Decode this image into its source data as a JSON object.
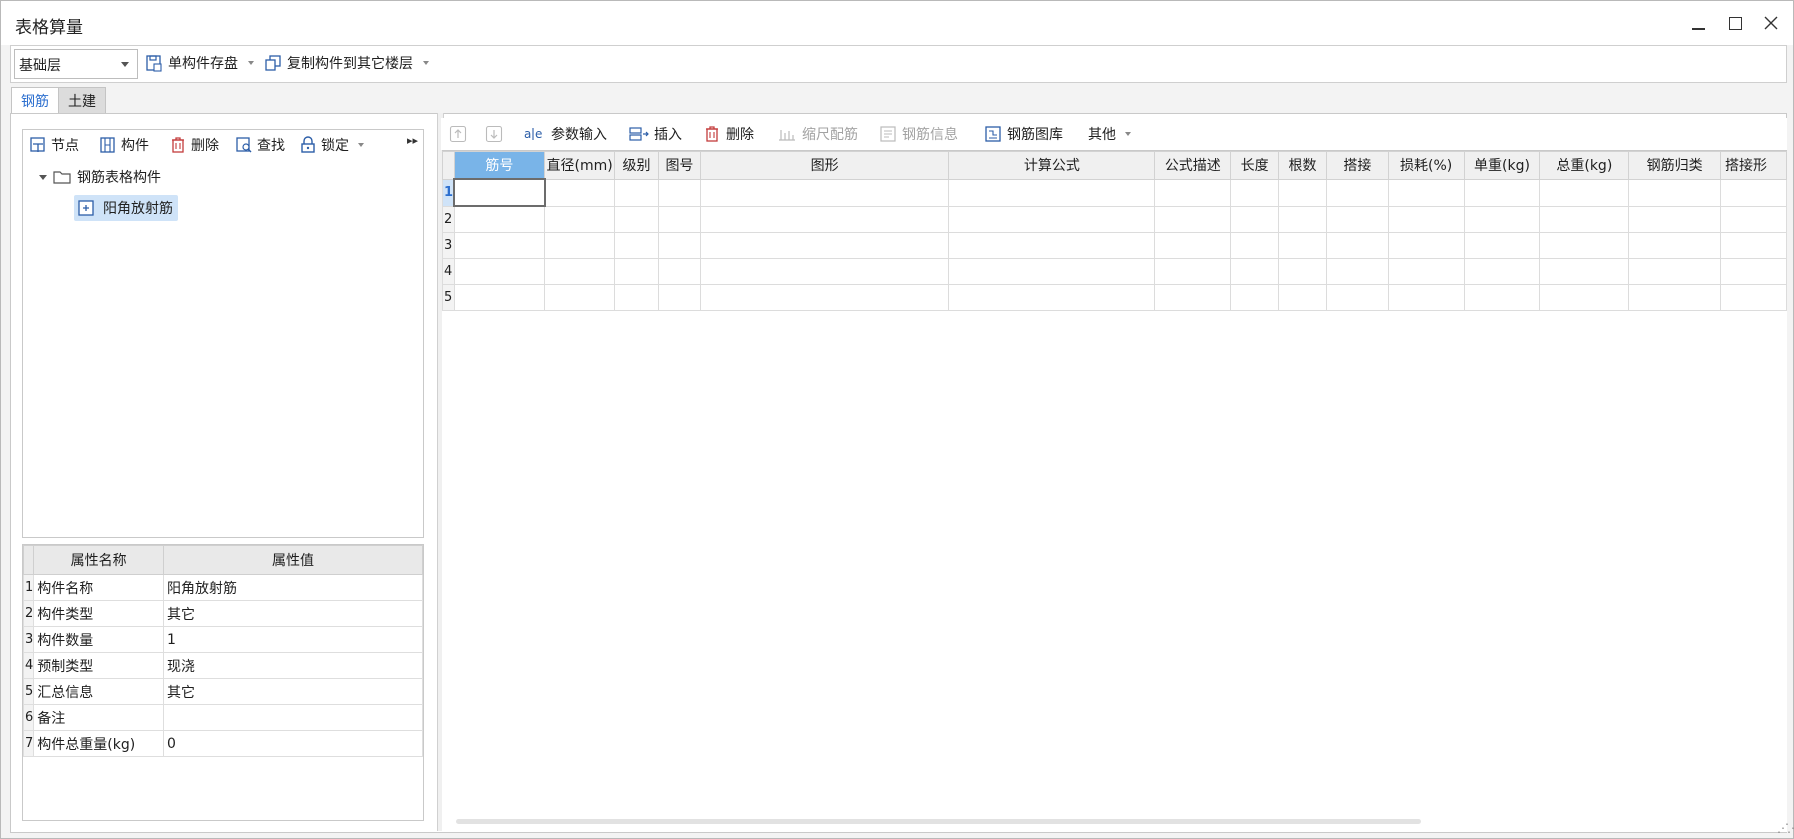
{
  "window": {
    "title": "表格算量"
  },
  "toolbar": {
    "floor_select": "基础层",
    "save_single": "单构件存盘",
    "copy_to_floor": "复制构件到其它楼层"
  },
  "tabs": [
    {
      "label": "钢筋",
      "active": true
    },
    {
      "label": "土建",
      "active": false
    }
  ],
  "left_toolbar": {
    "node": "节点",
    "component": "构件",
    "delete": "删除",
    "find": "查找",
    "lock": "锁定"
  },
  "tree": {
    "root": "钢筋表格构件",
    "child": "阳角放射筋"
  },
  "properties": {
    "headers": [
      "属性名称",
      "属性值"
    ],
    "rows": [
      {
        "n": "1",
        "name": "构件名称",
        "value": "阳角放射筋"
      },
      {
        "n": "2",
        "name": "构件类型",
        "value": "其它"
      },
      {
        "n": "3",
        "name": "构件数量",
        "value": "1"
      },
      {
        "n": "4",
        "name": "预制类型",
        "value": "现浇"
      },
      {
        "n": "5",
        "name": "汇总信息",
        "value": "其它"
      },
      {
        "n": "6",
        "name": "备注",
        "value": ""
      },
      {
        "n": "7",
        "name": "构件总重量(kg)",
        "value": "0"
      }
    ]
  },
  "right_toolbar": {
    "param_input": "参数输入",
    "insert": "插入",
    "delete": "删除",
    "scale_rebar": "缩尺配筋",
    "rebar_info": "钢筋信息",
    "rebar_library": "钢筋图库",
    "other": "其他"
  },
  "grid": {
    "columns": [
      "筋号",
      "直径(mm)",
      "级别",
      "图号",
      "图形",
      "计算公式",
      "公式描述",
      "长度",
      "根数",
      "搭接",
      "损耗(%)",
      "单重(kg)",
      "总重(kg)",
      "钢筋归类",
      "搭接形"
    ],
    "row_numbers": [
      "1",
      "2",
      "3",
      "4",
      "5"
    ]
  },
  "colors": {
    "accent": "#2c6fcf",
    "selected_header": "#79b4e8",
    "selected_row": "#cfe3f8"
  }
}
